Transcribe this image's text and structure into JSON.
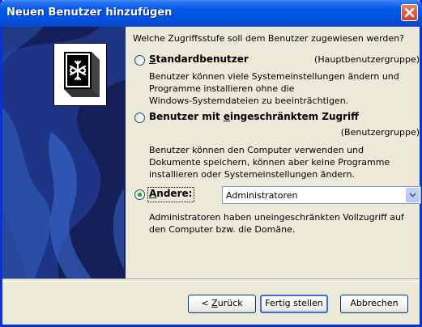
{
  "window": {
    "title": "Neuen Benutzer hinzufügen"
  },
  "question": "Welche Zugriffsstufe soll dem Benutzer zugewiesen werden?",
  "options": [
    {
      "label_pre": "",
      "label_u": "S",
      "label_post": "tandardbenutzer",
      "group": "(Hauptbenutzergruppe)",
      "desc": [
        "Benutzer können viele Systemeinstellungen ändern und",
        "Programme installieren ohne die",
        "Windows-Systemdateien zu beeinträchtigen."
      ],
      "checked": false
    },
    {
      "label_pre": "Benutzer mit ",
      "label_u": "e",
      "label_post": "ingeschränktem Zugriff",
      "group": "(Benutzergruppe)",
      "desc": [
        "Benutzer können den Computer verwenden und",
        "Dokumente speichern, können aber keine Programme",
        "installieren oder Systemeinstellungen ändern."
      ],
      "checked": false
    },
    {
      "label_pre": "",
      "label_u": "A",
      "label_post": "ndere:",
      "checked": true,
      "select_value": "Administratoren",
      "desc": [
        "Administratoren haben uneingeschränkten Vollzugriff auf",
        "den Computer bzw. die Domäne."
      ]
    }
  ],
  "buttons": {
    "back_pre": "< ",
    "back_u": "Z",
    "back_post": "urück",
    "finish": "Fertig stellen",
    "cancel": "Abbrechen"
  },
  "colors": {
    "titlebar": "#0053E1",
    "sidebar": "#15205A",
    "dialog_bg": "#ECE9D8",
    "radio_checked": "#21A121"
  }
}
